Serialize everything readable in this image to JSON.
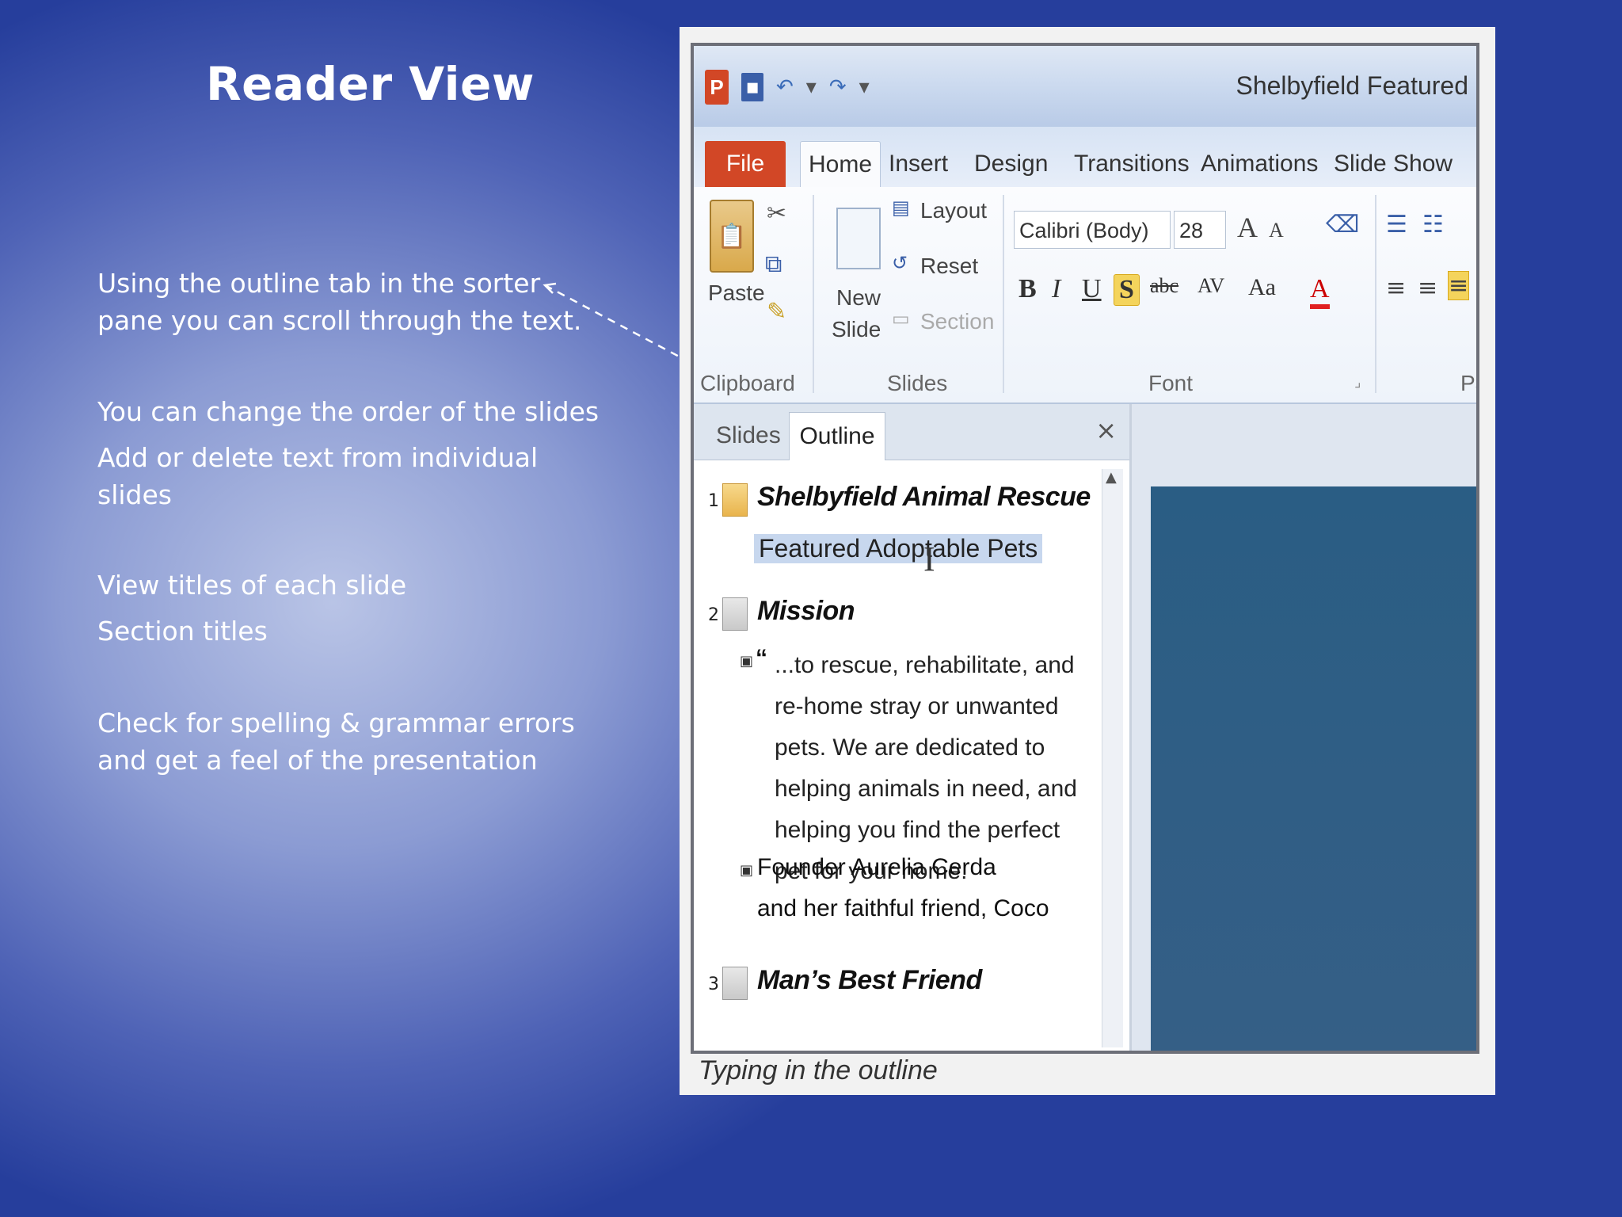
{
  "slide": {
    "title": "Reader View",
    "bullets": [
      "Using the outline tab in the sorter pane you can scroll through the text.",
      "You can change the order of the slides",
      "Add or delete text from individual slides",
      "View titles of each slide",
      "Section titles",
      "Check for spelling & grammar errors and get a feel of the presentation"
    ]
  },
  "screenshot": {
    "app_icon": "P",
    "document_title": "Shelbyfield Featured",
    "tabs": [
      "File",
      "Home",
      "Insert",
      "Design",
      "Transitions",
      "Animations",
      "Slide Show"
    ],
    "ribbon": {
      "clipboard": {
        "paste": "Paste",
        "group": "Clipboard"
      },
      "slides": {
        "new_slide_line1": "New",
        "new_slide_line2": "Slide",
        "layout": "Layout",
        "reset": "Reset",
        "section": "Section",
        "group": "Slides"
      },
      "font": {
        "font_name": "Calibri (Body)",
        "font_size": "28",
        "bold": "B",
        "italic": "I",
        "underline": "U",
        "shadow": "S",
        "strike": "abc",
        "spacing": "AV",
        "case": "Aa",
        "color": "A",
        "grow": "A",
        "shrink": "A",
        "group": "Font"
      },
      "paragraph": {
        "group": "Pa"
      }
    },
    "pane": {
      "tabs": [
        "Slides",
        "Outline"
      ],
      "close": "×",
      "outline": [
        {
          "num": "1",
          "title": "Shelbyfield Animal Rescue",
          "subtitle": "Featured Adoptable Pets"
        },
        {
          "num": "2",
          "title": "Mission",
          "quote_mark": "“",
          "body": "...to rescue, rehabilitate, and re-home stray or unwanted pets. We are dedicated to helping animals in need, and helping you find the perfect pet for your home.",
          "founder_line1": "Founder Aurelia Cerda",
          "founder_line2": "and her faithful friend, Coco"
        },
        {
          "num": "3",
          "title": "Man’s Best Friend"
        }
      ]
    },
    "caption": "Typing in the outline"
  },
  "colors": {
    "file_tab": "#d24726",
    "slide_bg": "#2a5d84",
    "highlight": "#c7d7ee"
  }
}
